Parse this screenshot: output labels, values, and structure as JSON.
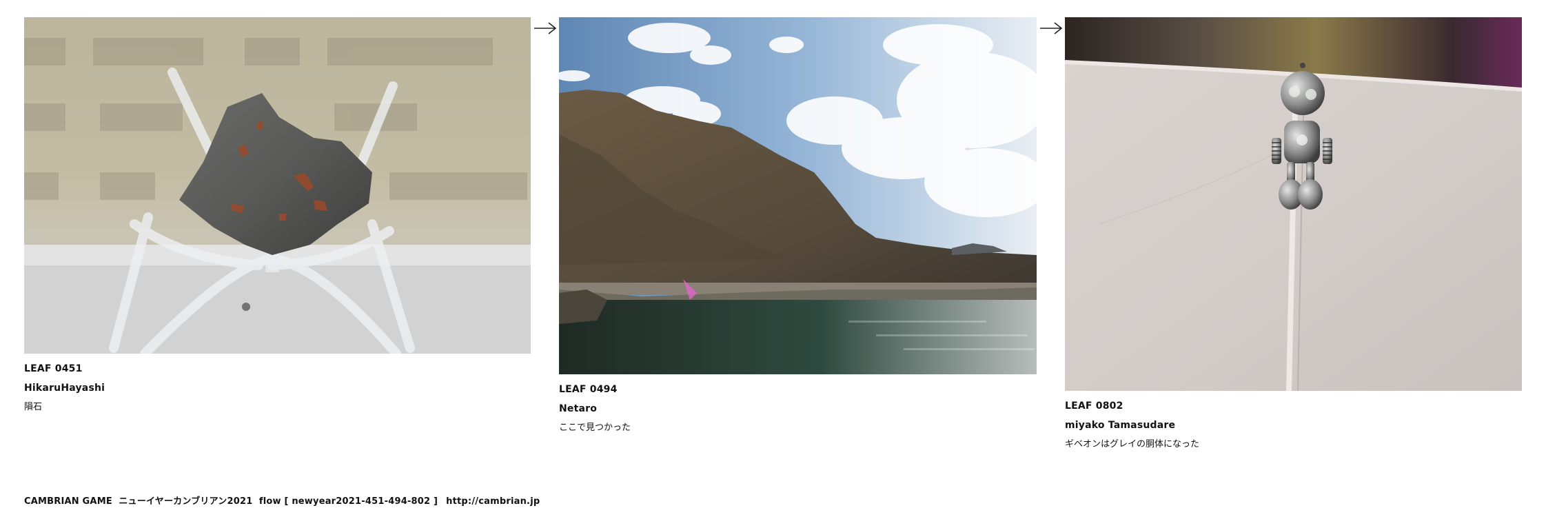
{
  "leaves": [
    {
      "id": "LEAF 0451",
      "author": "HikaruHayashi",
      "caption": "隕石",
      "image": "meteorite-on-acrylic-stand"
    },
    {
      "id": "LEAF 0494",
      "author": "Netaro",
      "caption": "ここで見つかった",
      "image": "coastal-cliff-and-bay"
    },
    {
      "id": "LEAF 0802",
      "author": "miyako Tamasudare",
      "caption": "ギベオンはグレイの胴体になった",
      "image": "metal-robot-charm-on-paper"
    }
  ],
  "arrows": [
    "right-arrow-icon",
    "right-arrow-icon"
  ],
  "footer": {
    "text": "CAMBRIAN GAME  ニューイヤーカンブリアン2021  flow [ newyear2021-451-494-802 ]",
    "link": "http://cambrian.jp"
  }
}
